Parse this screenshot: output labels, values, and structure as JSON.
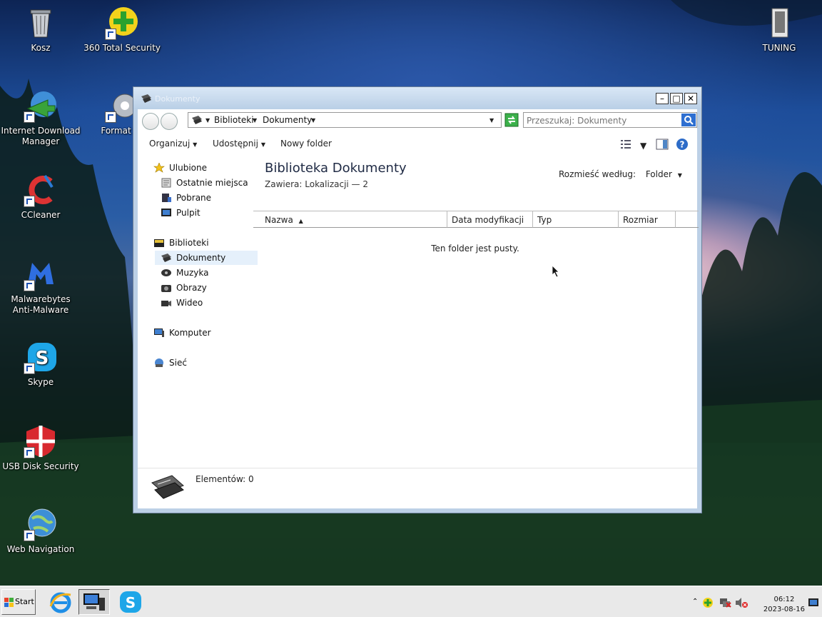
{
  "desktop": {
    "icons": [
      {
        "label": "Kosz"
      },
      {
        "label": "360 Total Security"
      },
      {
        "label": "TUNING"
      },
      {
        "label": "Internet Download Manager"
      },
      {
        "label": "Format Fa"
      },
      {
        "label": "CCleaner"
      },
      {
        "label": "Malwarebytes Anti-Malware"
      },
      {
        "label": "Skype"
      },
      {
        "label": "USB Disk Security"
      },
      {
        "label": "Web Navigation"
      }
    ]
  },
  "window": {
    "title": "Dokumenty",
    "address": {
      "crumbs": [
        "Biblioteki",
        "Dokumenty"
      ]
    },
    "search_placeholder": "Przeszukaj: Dokumenty",
    "toolbar": {
      "organize": "Organizuj",
      "share": "Udostępnij",
      "new_folder": "Nowy folder"
    },
    "nav": {
      "favorites": "Ulubione",
      "favorites_items": [
        "Ostatnie miejsca",
        "Pobrane",
        "Pulpit"
      ],
      "libraries": "Biblioteki",
      "libraries_items": [
        "Dokumenty",
        "Muzyka",
        "Obrazy",
        "Wideo"
      ],
      "computer": "Komputer",
      "network": "Sieć"
    },
    "content": {
      "title": "Biblioteka Dokumenty",
      "subtitle": "Zawiera:  Lokalizacji — 2",
      "arrange_label": "Rozmieść według:",
      "arrange_value": "Folder",
      "columns": [
        "Nazwa",
        "Data modyfikacji",
        "Typ",
        "Rozmiar"
      ],
      "empty_message": "Ten folder jest pusty."
    },
    "details": {
      "count": "Elementów: 0"
    }
  },
  "taskbar": {
    "start": "Start",
    "time": "06:12",
    "date": "2023-08-16"
  },
  "colors": {
    "selection": "#e5f0fb",
    "accent": "#1b4fb0"
  }
}
